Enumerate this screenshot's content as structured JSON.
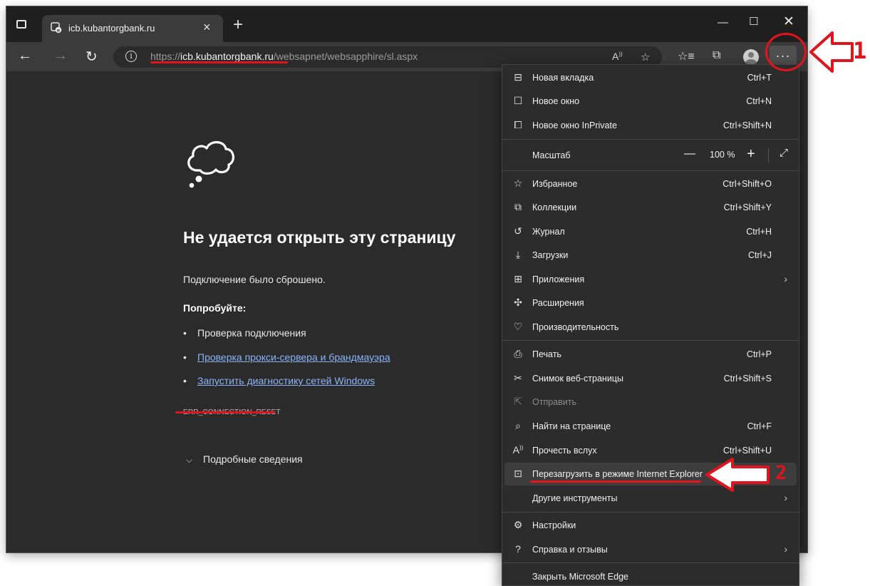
{
  "tab": {
    "title": "icb.kubantorgbank.ru"
  },
  "address": {
    "scheme": "https://",
    "host": "icb.kubantorgbank.ru",
    "path": "/websapnet/websapphire/sl.aspx"
  },
  "error_page": {
    "title": "Не удается открыть эту страницу",
    "subtitle": "Подключение было сброшено.",
    "try_label": "Попробуйте:",
    "suggestions": [
      {
        "text": "Проверка подключения",
        "link": false
      },
      {
        "text": "Проверка прокси-сервера и брандмауэра",
        "link": true
      },
      {
        "text": "Запустить диагностику сетей Windows",
        "link": true
      }
    ],
    "error_code": "ERR_CONNECTION_RESET",
    "details_label": "Подробные сведения"
  },
  "menu": {
    "items": [
      {
        "label": "Новая вкладка",
        "shortcut": "Ctrl+T",
        "icon": "new-tab-icon"
      },
      {
        "label": "Новое окно",
        "shortcut": "Ctrl+N",
        "icon": "new-window-icon"
      },
      {
        "label": "Новое окно InPrivate",
        "shortcut": "Ctrl+Shift+N",
        "icon": "inprivate-icon"
      },
      {
        "label": "Масштаб",
        "zoom": "100 %"
      },
      {
        "label": "Избранное",
        "shortcut": "Ctrl+Shift+O",
        "icon": "favorites-icon"
      },
      {
        "label": "Коллекции",
        "shortcut": "Ctrl+Shift+Y",
        "icon": "collections-icon"
      },
      {
        "label": "Журнал",
        "shortcut": "Ctrl+H",
        "icon": "history-icon"
      },
      {
        "label": "Загрузки",
        "shortcut": "Ctrl+J",
        "icon": "downloads-icon"
      },
      {
        "label": "Приложения",
        "submenu": true,
        "icon": "apps-icon"
      },
      {
        "label": "Расширения",
        "icon": "extensions-icon"
      },
      {
        "label": "Производительность",
        "icon": "performance-icon"
      },
      {
        "label": "Печать",
        "shortcut": "Ctrl+P",
        "icon": "print-icon"
      },
      {
        "label": "Снимок веб-страницы",
        "shortcut": "Ctrl+Shift+S",
        "icon": "web-capture-icon"
      },
      {
        "label": "Отправить",
        "disabled": true,
        "icon": "share-icon"
      },
      {
        "label": "Найти на странице",
        "shortcut": "Ctrl+F",
        "icon": "find-icon"
      },
      {
        "label": "Прочесть вслух",
        "shortcut": "Ctrl+Shift+U",
        "icon": "read-aloud-icon"
      },
      {
        "label": "Перезагрузить в режиме Internet Explorer",
        "icon": "ie-mode-icon",
        "highlighted": true
      },
      {
        "label": "Другие инструменты",
        "submenu": true
      },
      {
        "label": "Настройки",
        "icon": "settings-icon"
      },
      {
        "label": "Справка и отзывы",
        "submenu": true,
        "icon": "help-icon"
      },
      {
        "label": "Закрыть Microsoft Edge"
      }
    ]
  },
  "annotations": {
    "one": "1",
    "two": "2",
    "color": "#e0141e"
  },
  "colors": {
    "link": "#8ab4f8",
    "page_bg": "#2b2b2b",
    "menu_bg": "#2c2c2c"
  }
}
